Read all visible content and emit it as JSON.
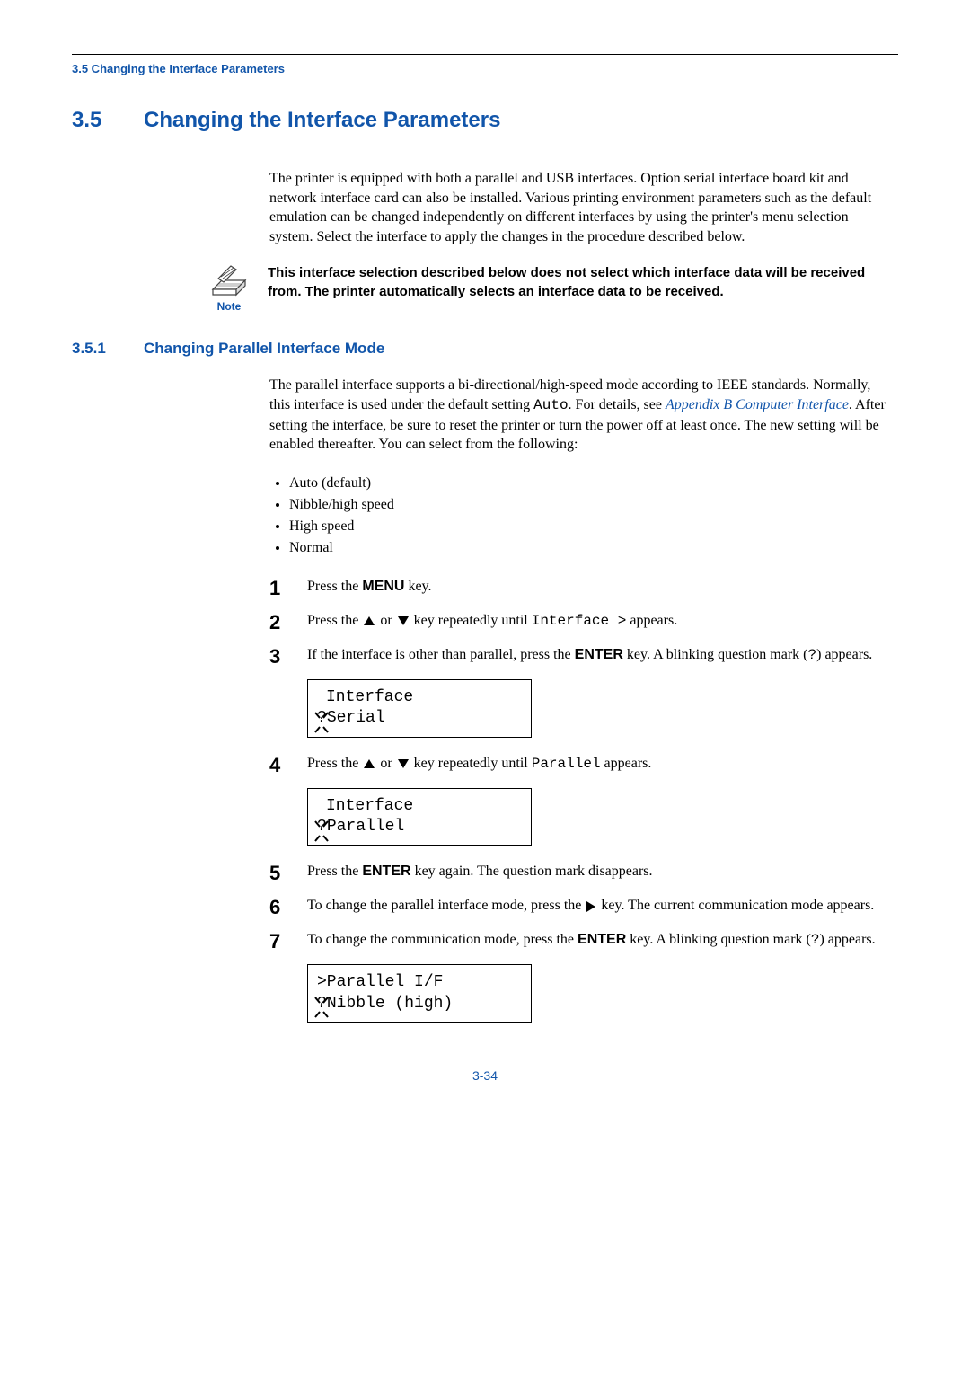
{
  "header": {
    "breadcrumb": "3.5 Changing the Interface Parameters"
  },
  "section": {
    "number": "3.5",
    "title": "Changing the Interface Parameters",
    "intro": "The printer is equipped with both a parallel and USB interfaces. Option serial interface board kit and network interface card can also be installed. Various printing environment parameters such as the default emulation can be changed independently on different interfaces by using the printer's menu selection system. Select the interface to apply the changes in the procedure described below."
  },
  "note": {
    "label": "Note",
    "text": "This interface selection described below does not select which interface data will be received from. The printer automatically selects an interface data to be received."
  },
  "subsection": {
    "number": "3.5.1",
    "title": "Changing Parallel Interface Mode",
    "intro_pre": "The parallel interface supports a bi-directional/high-speed mode according to IEEE standards. Normally, this interface is used under the default setting ",
    "intro_code": "Auto",
    "intro_mid": ". For details, see ",
    "intro_link": "Appendix B Computer Interface",
    "intro_post": ". After setting the interface, be sure to reset the printer or turn the power off at least once. The new setting will be enabled thereafter. You can select from the following:",
    "bullets": [
      "Auto (default)",
      "Nibble/high speed",
      "High speed",
      "Normal"
    ]
  },
  "steps": {
    "s1": {
      "pre": "Press the ",
      "key": "MENU",
      "post": " key."
    },
    "s2": {
      "pre": "Press the ",
      "mid": " or ",
      "post1": " key repeatedly until ",
      "code": "Interface >",
      "post2": " appears."
    },
    "s3": {
      "pre": "If the interface is other than parallel, press the ",
      "key": "ENTER",
      "post1": " key. A blinking question mark (",
      "code": "?",
      "post2": ") appears."
    },
    "lcd1": {
      "line1": "Interface",
      "q": "?",
      "line2": " Serial"
    },
    "s4": {
      "pre": "Press the ",
      "mid": " or ",
      "post1": " key repeatedly until ",
      "code": "Parallel",
      "post2": " appears."
    },
    "lcd2": {
      "line1": "Interface",
      "q": "?",
      "line2": " Parallel"
    },
    "s5": {
      "pre": "Press the ",
      "key": "ENTER",
      "post": " key again. The question mark disappears."
    },
    "s6": {
      "pre": "To change the parallel interface mode, press the ",
      "post": " key. The current communication mode appears."
    },
    "s7": {
      "pre": "To change the communication mode, press the ",
      "key": "ENTER",
      "post1": " key. A blinking question mark (",
      "code": "?",
      "post2": ") appears."
    },
    "lcd3": {
      "line1": ">Parallel I/F",
      "q": "?",
      "line2": " Nibble (high)"
    }
  },
  "footer": {
    "page": "3-34"
  }
}
